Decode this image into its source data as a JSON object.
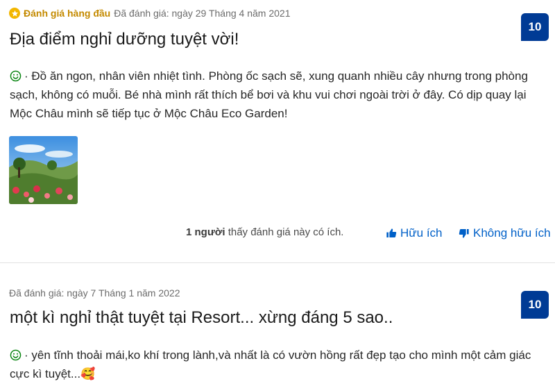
{
  "reviews": [
    {
      "top_badge": "Đánh giá hàng đầu",
      "date": "Đã đánh giá: ngày 29 Tháng 4 năm 2021",
      "title": "Địa điểm nghỉ dưỡng tuyệt vời!",
      "score": "10",
      "text": "· Đồ ăn ngon, nhân viên nhiệt tình. Phòng ốc sạch sẽ, xung quanh nhiều cây nhưng trong phòng sạch, không có muỗi. Bé nhà mình rất thích bể bơi và khu vui chơi ngoài trời ở đây. Có dịp quay lại Mộc Châu mình sẽ tiếp tục ở Mộc Châu Eco Garden!",
      "helpful_count": "1 người",
      "helpful_suffix": " thấy đánh giá này có ích.",
      "helpful_label": "Hữu ích",
      "not_helpful_label": "Không hữu ích"
    },
    {
      "date": "Đã đánh giá: ngày 7 Tháng 1 năm 2022",
      "title": "một kì nghỉ thật tuyệt tại Resort... xừng đáng 5 sao..",
      "score": "10",
      "text": "· yên tĩnh thoải mái,ko khí trong lành,và nhất là có vườn hồng rất đẹp tạo cho mình một cảm giác cực kì tuyệt...",
      "emoji": "🥰"
    }
  ],
  "colors": {
    "score_bg": "#003b95",
    "link": "#0060c8",
    "top_badge": "#c48a00",
    "smile_icon": "#008009"
  },
  "icons": [
    "star-icon",
    "smile-icon",
    "thumbs-up-icon",
    "thumbs-down-icon"
  ]
}
